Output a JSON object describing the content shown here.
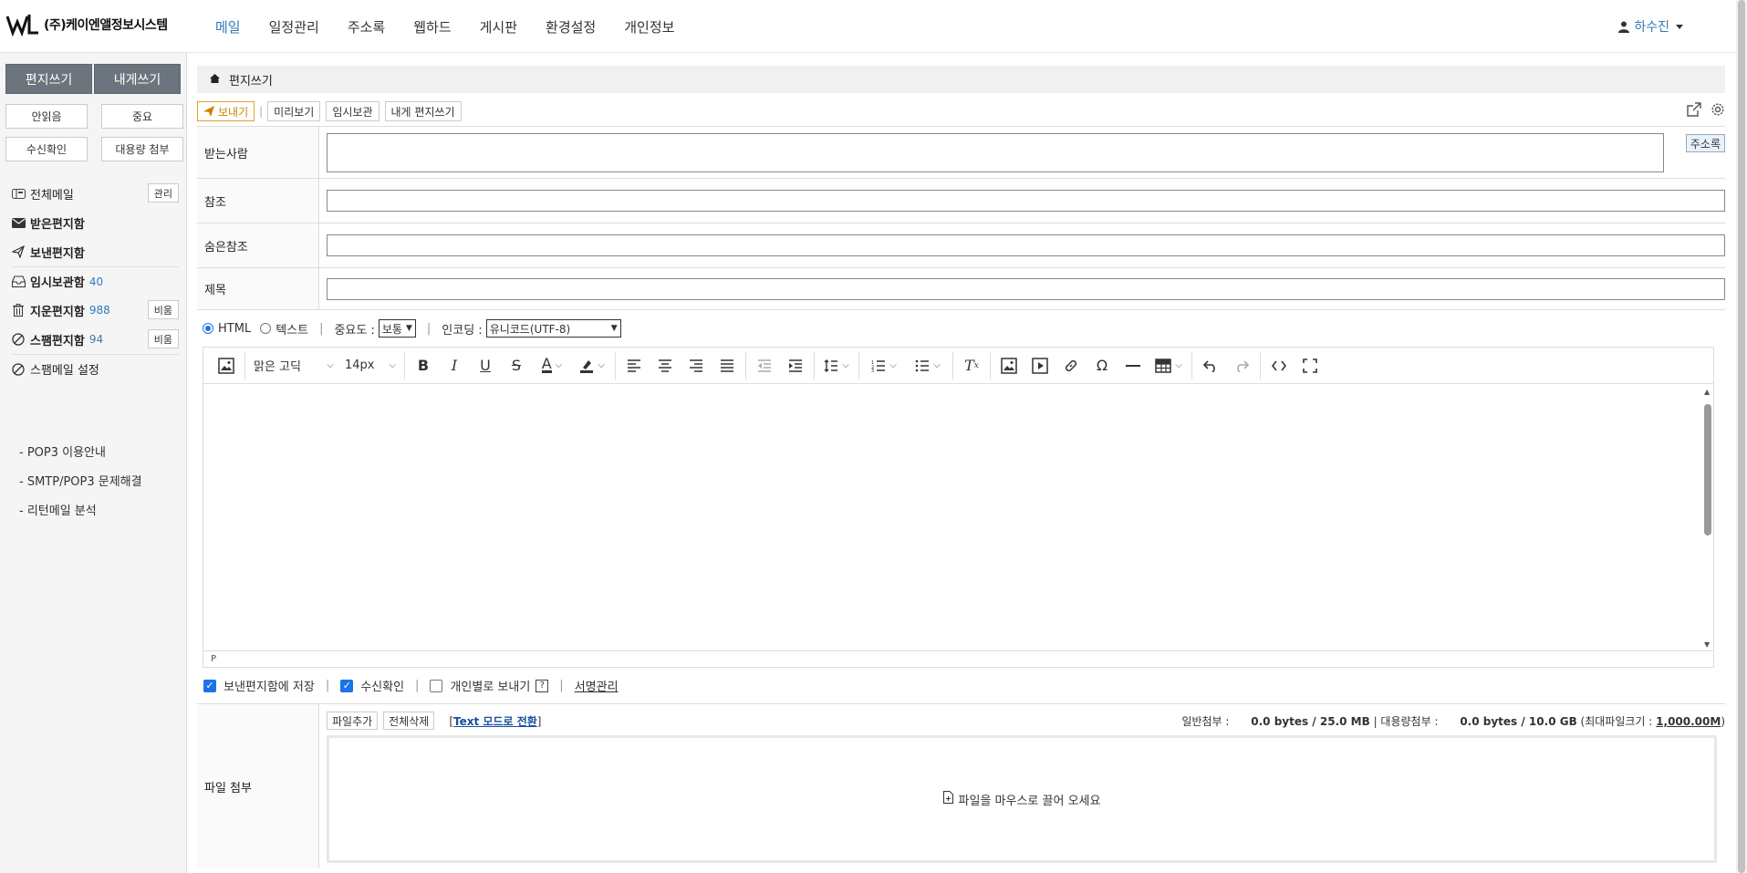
{
  "header": {
    "company": "(주)케이엔앨정보시스템",
    "nav": [
      "메일",
      "일정관리",
      "주소록",
      "웹하드",
      "게시판",
      "환경설정",
      "개인정보"
    ],
    "active_index": 0,
    "user": "하수진"
  },
  "sidebar": {
    "compose_label": "편지쓰기",
    "self_compose_label": "내게쓰기",
    "quick": [
      "안읽음",
      "중요",
      "수신확인",
      "대용량 첨부"
    ],
    "folders": [
      {
        "name": "전체메일",
        "count": "",
        "button": "관리",
        "icon": "mailbox-icon",
        "bold": false
      },
      {
        "name": "받은편지함",
        "count": "",
        "button": "",
        "icon": "envelope-icon",
        "bold": true
      },
      {
        "name": "보낸편지함",
        "count": "",
        "button": "",
        "icon": "send-icon",
        "bold": true
      },
      {
        "name": "임시보관함",
        "count": "40",
        "button": "",
        "icon": "inbox-tray-icon",
        "bold": true
      },
      {
        "name": "지운편지함",
        "count": "988",
        "button": "비움",
        "icon": "trash-icon",
        "bold": true
      },
      {
        "name": "스팸편지함",
        "count": "94",
        "button": "비움",
        "icon": "ban-icon",
        "bold": true
      },
      {
        "name": "스팸메일 설정",
        "count": "",
        "button": "",
        "icon": "ban-icon",
        "bold": false
      }
    ],
    "links": [
      "- POP3 이용안내",
      "- SMTP/POP3 문제해결",
      "- 리턴메일 분석"
    ]
  },
  "main": {
    "breadcrumb": "편지쓰기",
    "toolbar": {
      "send": "보내기",
      "preview": "미리보기",
      "save_draft": "임시보관",
      "to_self": "내게 편지쓰기"
    },
    "fields": {
      "to": "받는사람",
      "cc": "참조",
      "bcc": "숨은참조",
      "subject": "제목",
      "address_book": "주소록"
    },
    "options": {
      "html": "HTML",
      "text": "텍스트",
      "priority_label": "중요도 :",
      "priority_value": "보통",
      "encoding_label": "인코딩 :",
      "encoding_value": "유니코드(UTF-8)"
    },
    "editor": {
      "font": "맑은 고딕",
      "size": "14px",
      "status": "P"
    },
    "checks": {
      "save_sent": "보낸편지함에 저장",
      "receipt": "수신확인",
      "individual": "개인별로 보내기",
      "help": "?",
      "signature": "서명관리",
      "save_sent_on": true,
      "receipt_on": true,
      "individual_on": false
    },
    "attach": {
      "label": "파일 첨부",
      "add": "파일추가",
      "delete_all": "전체삭제",
      "mode_switch": "Text 모드로 전환",
      "normal_label": "일반첨부 :",
      "normal_value": "0.0 bytes / 25.0 MB",
      "large_label": "| 대용량첨부 :",
      "large_value": "0.0 bytes / 10.0 GB",
      "max_label": "(최대파일크기 :",
      "max_value": "1,000.00M",
      "close_paren": ")",
      "drop_hint": "파일을 마우스로 끌어 오세요"
    }
  }
}
